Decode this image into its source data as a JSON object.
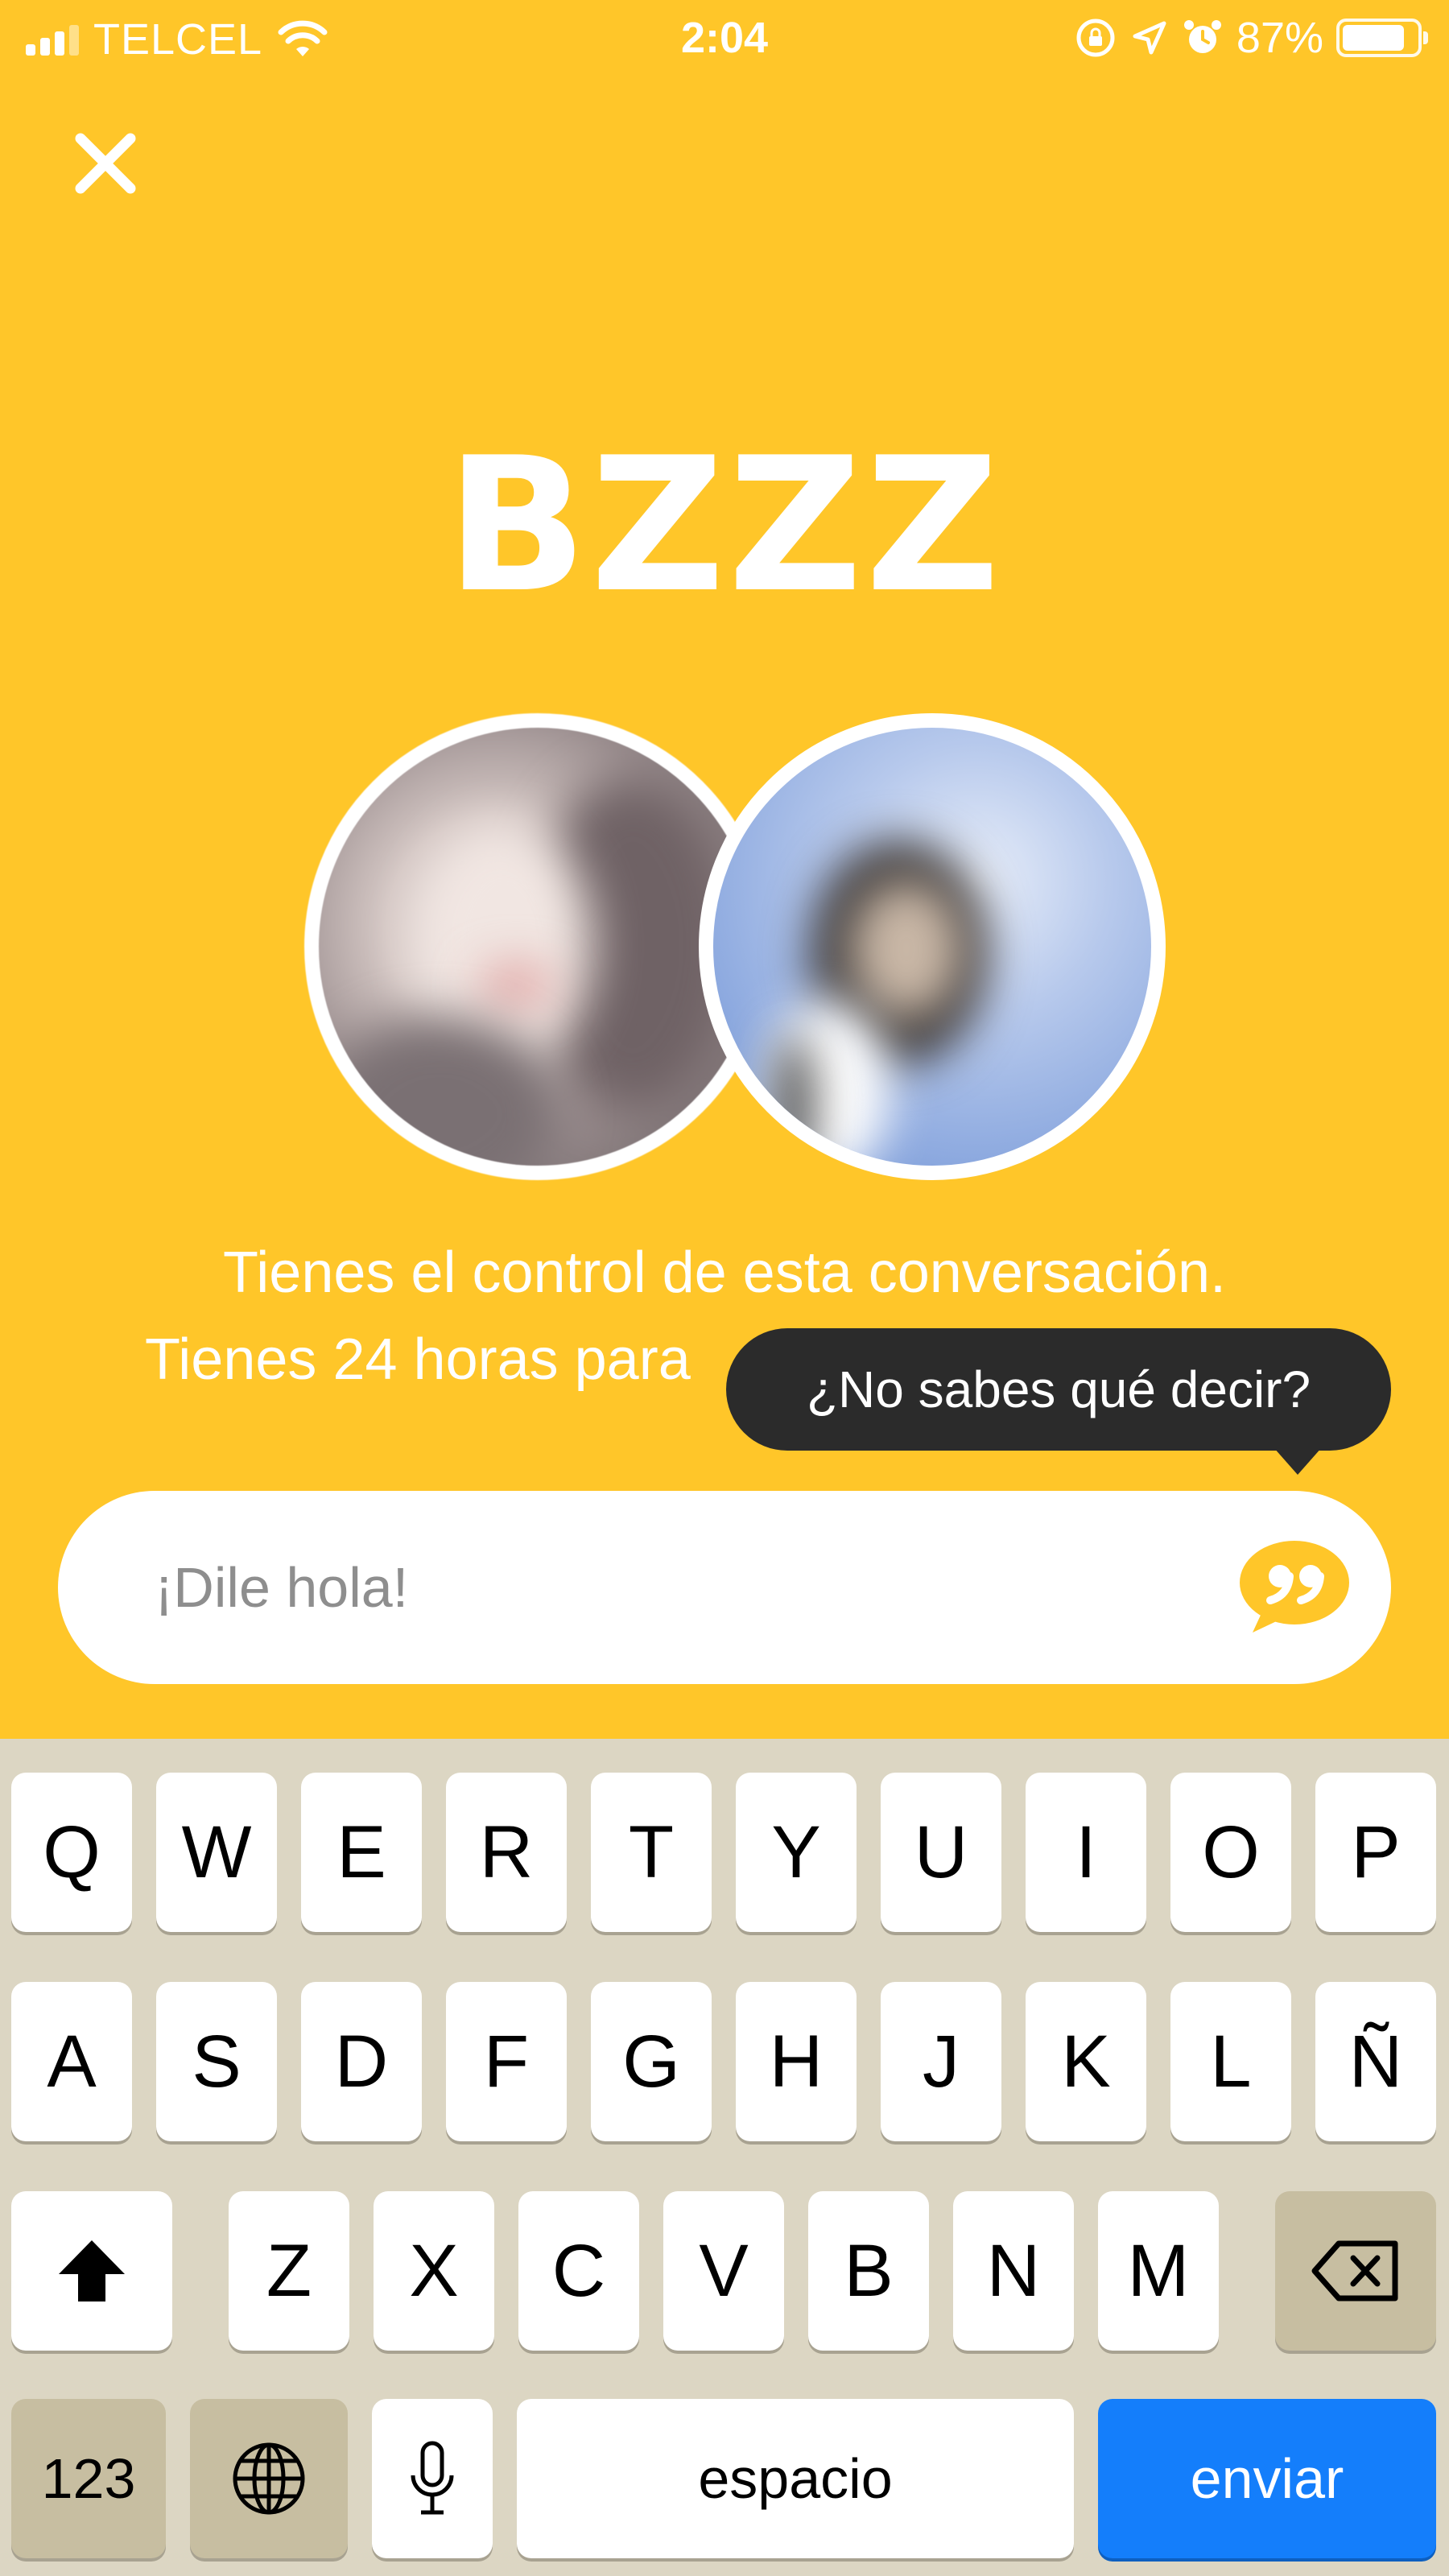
{
  "status_bar": {
    "carrier": "TELCEL",
    "time": "2:04",
    "battery": "87%"
  },
  "match": {
    "title": "BZZZ",
    "line1": "Tienes el control de esta conversación.",
    "line2": "Tienes 24 horas para"
  },
  "tooltip": {
    "text": "¿No sabes qué decir?"
  },
  "input": {
    "placeholder": "¡Dile hola!"
  },
  "keyboard": {
    "row1": [
      "Q",
      "W",
      "E",
      "R",
      "T",
      "Y",
      "U",
      "I",
      "O",
      "P"
    ],
    "row2": [
      "A",
      "S",
      "D",
      "F",
      "G",
      "H",
      "J",
      "K",
      "L",
      "Ñ"
    ],
    "row3": [
      "Z",
      "X",
      "C",
      "V",
      "B",
      "N",
      "M"
    ],
    "numbers_label": "123",
    "space_label": "espacio",
    "send_label": "enviar"
  },
  "colors": {
    "background": "#FFC629",
    "tooltip": "#2B2B2B",
    "send_key": "#147EFB"
  }
}
